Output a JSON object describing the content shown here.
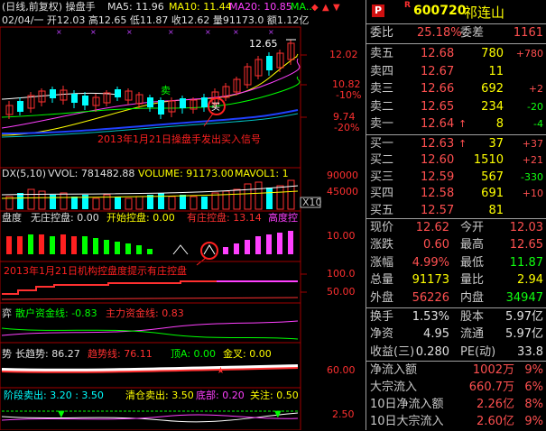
{
  "chart": {
    "header": {
      "title": "(日线,前复权) 操盘手",
      "ma5": "MA5: 11.96",
      "ma10": "MA10: 11.44",
      "ma20": "MA20: 10.85",
      "ma_more": "MA...",
      "ohlc_line": "02/04/一  开12.03 高12.65 低11.87 收12.62 量91173.0 额1.12亿"
    },
    "price_axis": [
      "12.02",
      "10.82",
      "-10%",
      "9.74",
      "-20%"
    ],
    "high_label": "12.65",
    "buy_mark": "卖",
    "circle_mark": "买",
    "annotation1": "2013年1月21日操盘手发出买入信号",
    "vol_header": {
      "title": "DX(5,10)",
      "vvol": "VVOL: 781482.88",
      "volume": "VOLUME: 91173.00",
      "mavol": "MAVOL1: 1"
    },
    "vol_axis": [
      "90000",
      "45000",
      "X10"
    ],
    "ctrl_header": {
      "title": "盘度",
      "none": "无庄控盘: 0.00",
      "start": "开始控盘: 0.00",
      "has": "有庄控盘: 13.14",
      "high": "高度控"
    },
    "ctrl_axis": [
      "10.00"
    ],
    "annotation2": "2013年1月21日机构控盘度提示有庄控盘",
    "trend_axis": [
      "100.0",
      "50.00"
    ],
    "fund_header": {
      "title": "弈",
      "retail": "散户资金线: -0.83",
      "main": "主力资金线: 0.83"
    },
    "long_header": {
      "title": "势",
      "long": "长趋势: 86.27",
      "trend": "趋势线: 76.11",
      "top": "顶A: 0.00",
      "gold": "金叉: 0.00"
    },
    "long_axis": [
      "60.00"
    ],
    "stage_header": {
      "sell": "阶段卖出: 3.20 : 3.50",
      "clear": "清仓卖出: 3.50",
      "bottom": "底部: 0.20",
      "focus": "关注: 0.50"
    },
    "stage_axis": [
      "2.50"
    ]
  },
  "quote": {
    "badge": "P",
    "r_mark": "R",
    "code": "600720",
    "name": "祁连山",
    "ratio": {
      "l1": "委比",
      "v1": "25.18%",
      "l2": "委差",
      "v2": "1161"
    },
    "sells": [
      {
        "label": "卖五",
        "price": "12.68",
        "vol": "780",
        "chg": "+780"
      },
      {
        "label": "卖四",
        "price": "12.67",
        "vol": "11",
        "chg": ""
      },
      {
        "label": "卖三",
        "price": "12.66",
        "vol": "692",
        "chg": "+2"
      },
      {
        "label": "卖二",
        "price": "12.65",
        "vol": "234",
        "chg": "-20"
      },
      {
        "label": "卖一",
        "price": "12.64",
        "arrow": "↑",
        "vol": "8",
        "chg": "-4"
      }
    ],
    "buys": [
      {
        "label": "买一",
        "price": "12.63",
        "arrow": "↑",
        "vol": "37",
        "chg": "+37"
      },
      {
        "label": "买二",
        "price": "12.60",
        "vol": "1510",
        "chg": "+21"
      },
      {
        "label": "买三",
        "price": "12.59",
        "vol": "567",
        "chg": "-330"
      },
      {
        "label": "买四",
        "price": "12.58",
        "vol": "691",
        "chg": "+10"
      },
      {
        "label": "买五",
        "price": "12.57",
        "vol": "81",
        "chg": ""
      }
    ],
    "stats": [
      {
        "l1": "现价",
        "v1": "12.62",
        "l2": "今开",
        "v2": "12.03"
      },
      {
        "l1": "涨跌",
        "v1": "0.60",
        "l2": "最高",
        "v2": "12.65"
      },
      {
        "l1": "涨幅",
        "v1": "4.99%",
        "l2": "最低",
        "v2": "11.87"
      },
      {
        "l1": "总量",
        "v1": "91173",
        "l2": "量比",
        "v2": "2.94"
      },
      {
        "l1": "外盘",
        "v1": "56226",
        "l2": "内盘",
        "v2": "34947"
      }
    ],
    "fin": [
      {
        "l1": "换手",
        "v1": "1.53%",
        "l2": "股本",
        "v2": "5.97亿"
      },
      {
        "l1": "净资",
        "v1": "4.95",
        "l2": "流通",
        "v2": "5.97亿"
      },
      {
        "l1": "收益(三)",
        "v1": "0.280",
        "l2": "PE(动)",
        "v2": "33.8"
      }
    ],
    "flow": [
      {
        "label": "净流入额",
        "value": "1002万",
        "pct": "9%"
      },
      {
        "label": "大宗流入",
        "value": "660.7万",
        "pct": "6%"
      },
      {
        "label": "10日净流入额",
        "value": "2.26亿",
        "pct": "8%"
      },
      {
        "label": "10日大宗流入",
        "value": "2.60亿",
        "pct": "9%"
      }
    ]
  },
  "colors": {
    "up": "#ff3030",
    "down": "#00ffff",
    "neutral": "#c0c0c0",
    "highlight": "#ffff00",
    "green": "#10ff10"
  }
}
